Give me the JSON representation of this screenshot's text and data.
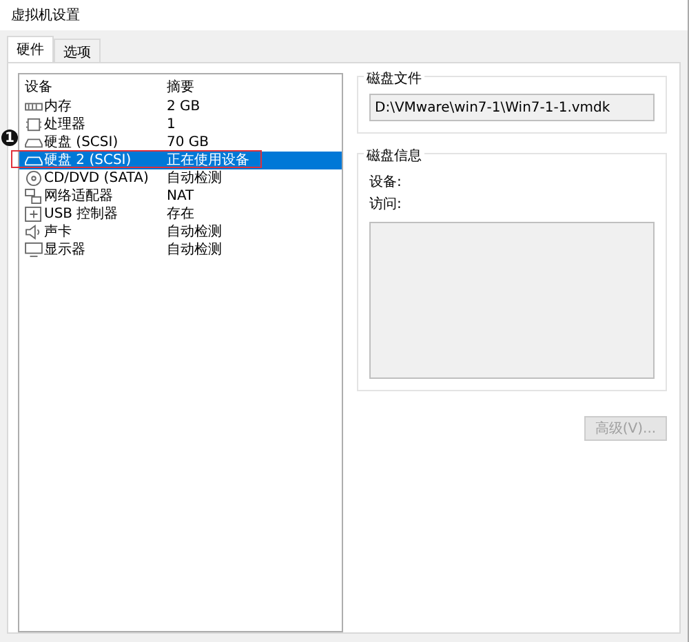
{
  "window": {
    "title": "虚拟机设置"
  },
  "tabs": [
    {
      "label": "硬件",
      "selected": true
    },
    {
      "label": "选项",
      "selected": false
    }
  ],
  "device_list": {
    "columns": [
      "设备",
      "摘要"
    ],
    "rows": [
      {
        "kind": "memory",
        "name": "内存",
        "summary": "2 GB",
        "selected": false
      },
      {
        "kind": "cpu",
        "name": "处理器",
        "summary": "1",
        "selected": false
      },
      {
        "kind": "disk",
        "name": "硬盘 (SCSI)",
        "summary": "70 GB",
        "selected": false
      },
      {
        "kind": "disk",
        "name": "硬盘 2 (SCSI)",
        "summary": "正在使用设备",
        "selected": true
      },
      {
        "kind": "cd",
        "name": "CD/DVD (SATA)",
        "summary": "自动检测",
        "selected": false
      },
      {
        "kind": "network",
        "name": "网络适配器",
        "summary": "NAT",
        "selected": false
      },
      {
        "kind": "usb",
        "name": "USB 控制器",
        "summary": "存在",
        "selected": false
      },
      {
        "kind": "sound",
        "name": "声卡",
        "summary": "自动检测",
        "selected": false
      },
      {
        "kind": "display",
        "name": "显示器",
        "summary": "自动检测",
        "selected": false
      }
    ]
  },
  "callout": {
    "number": "1"
  },
  "disk_file": {
    "label": "磁盘文件",
    "value": "D:\\VMware\\win7-1\\Win7-1-1.vmdk"
  },
  "disk_info": {
    "label": "磁盘信息",
    "fields": [
      "设备:",
      "访问:"
    ]
  },
  "advanced_button": {
    "label": "高级(V)...",
    "disabled": true
  }
}
